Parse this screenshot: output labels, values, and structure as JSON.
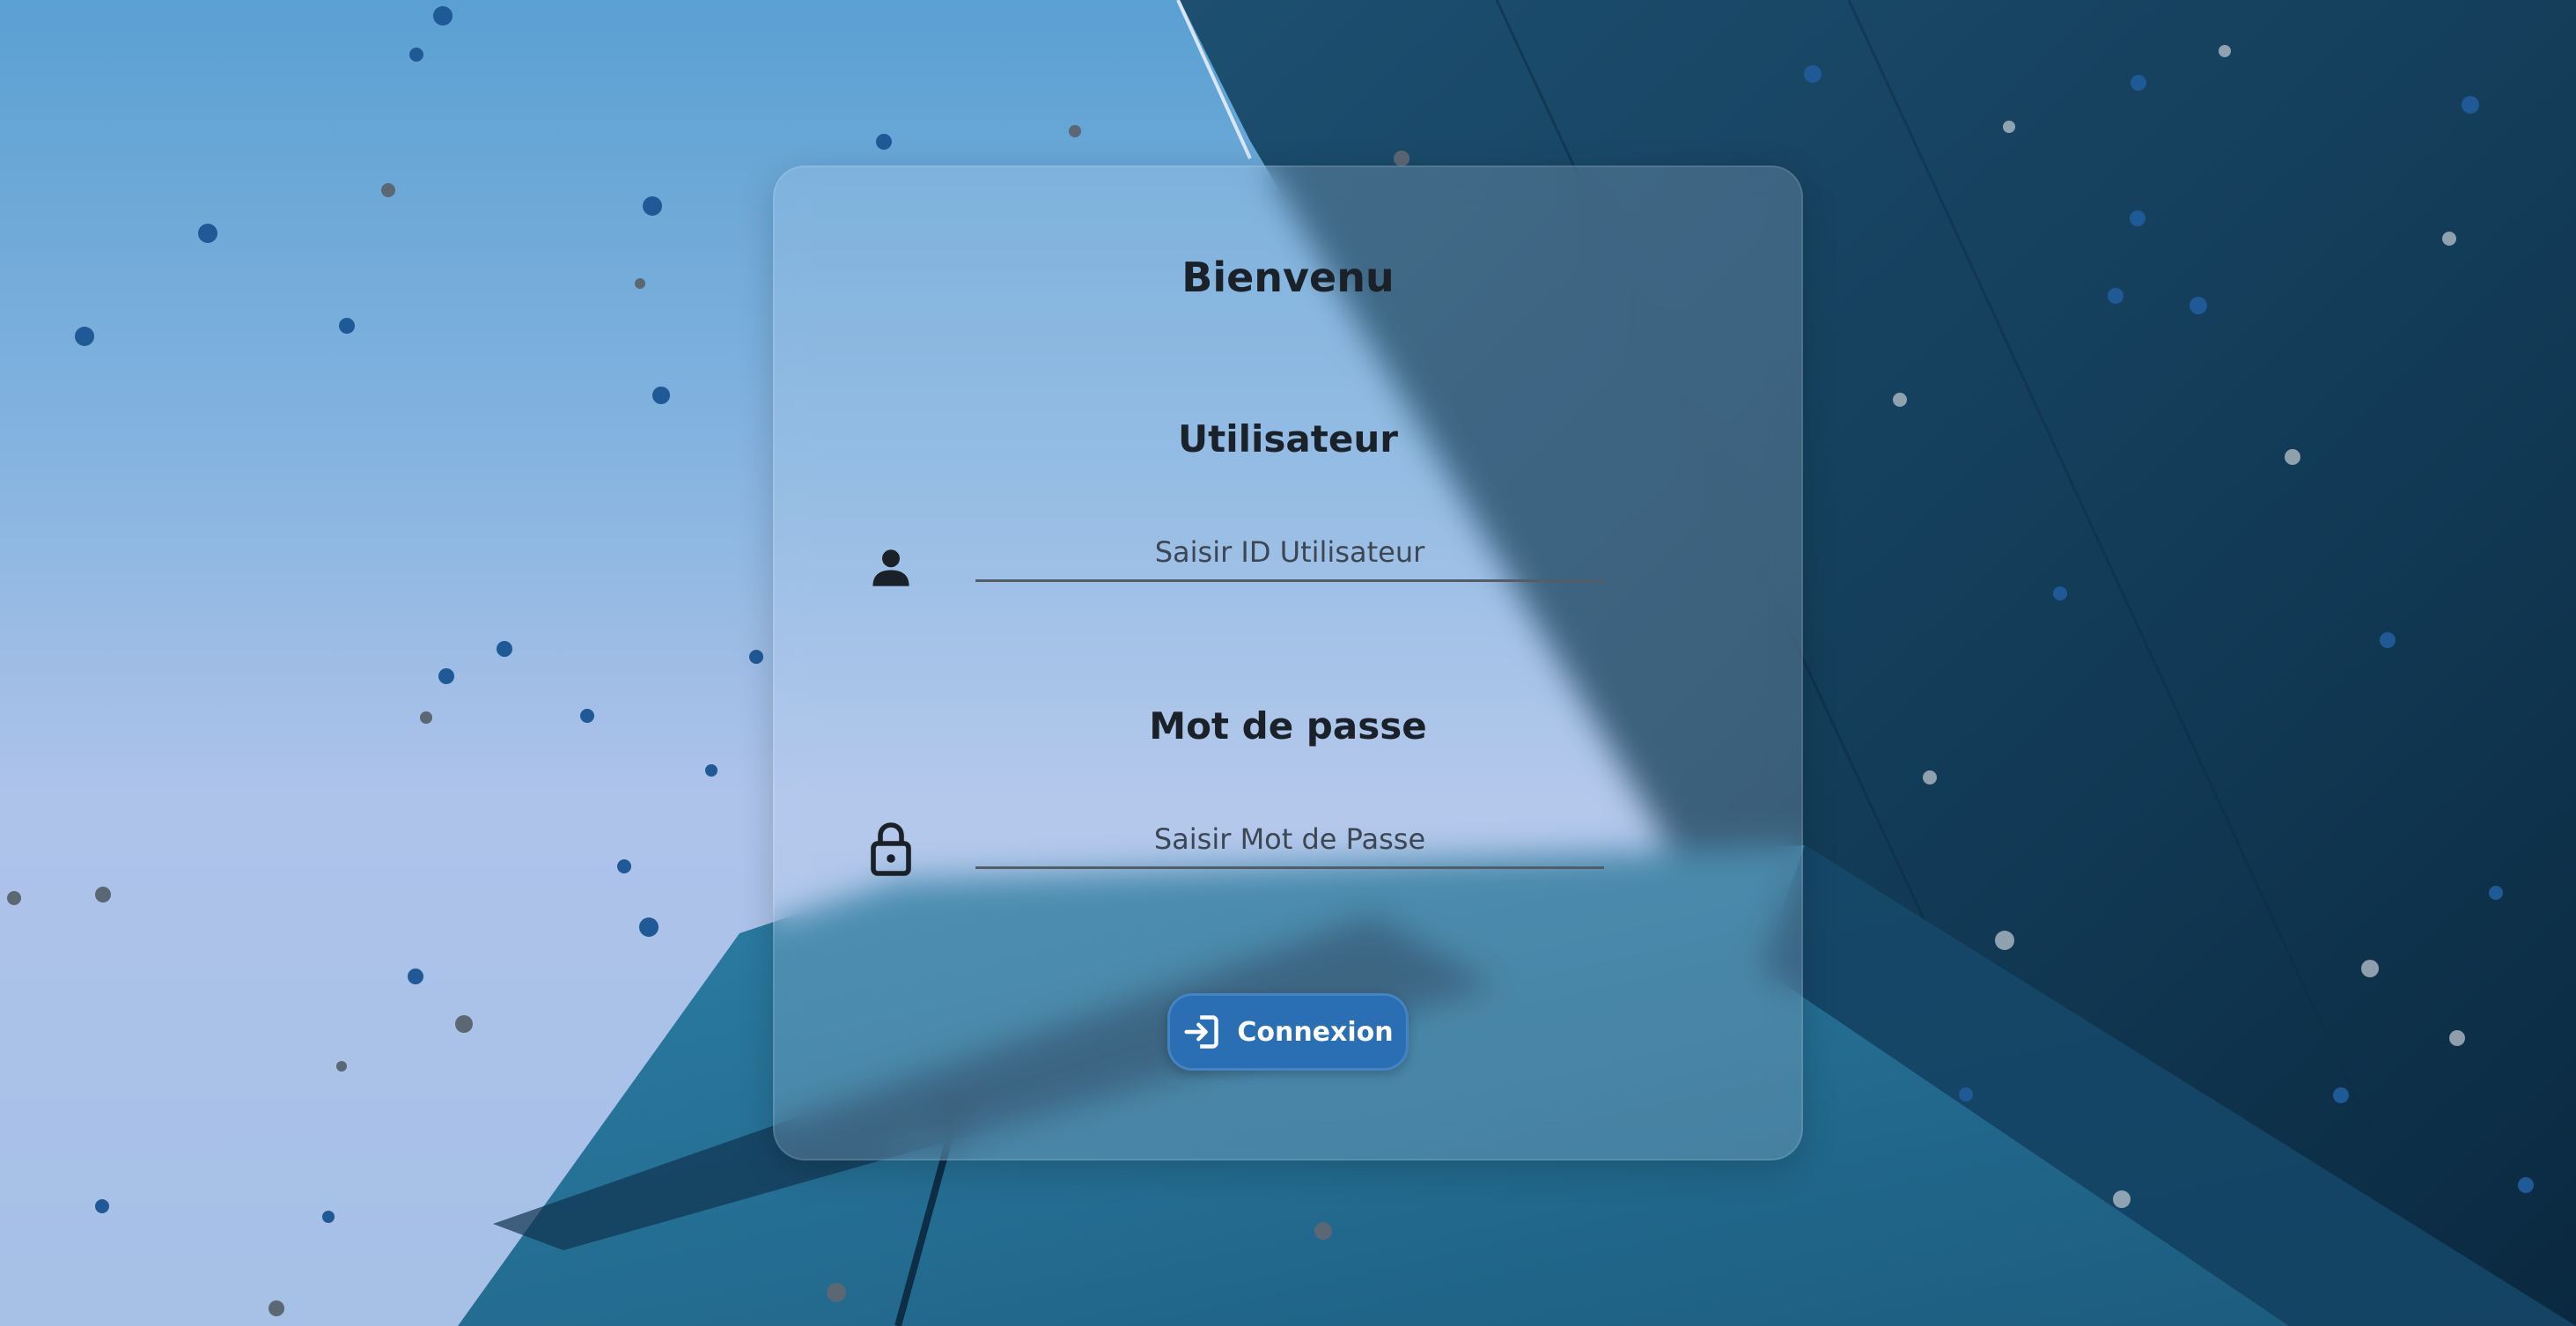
{
  "page": {
    "welcome_title": "Bienvenu",
    "accent_color": "#2a6fb4"
  },
  "form": {
    "user_label": "Utilisateur",
    "user_placeholder": "Saisir ID Utilisateur",
    "user_icon": "person-icon",
    "password_label": "Mot de passe",
    "password_placeholder": "Saisir Mot de Passe",
    "password_icon": "lock-icon",
    "login_button": "Connexion",
    "login_icon": "login-arrow-icon"
  }
}
